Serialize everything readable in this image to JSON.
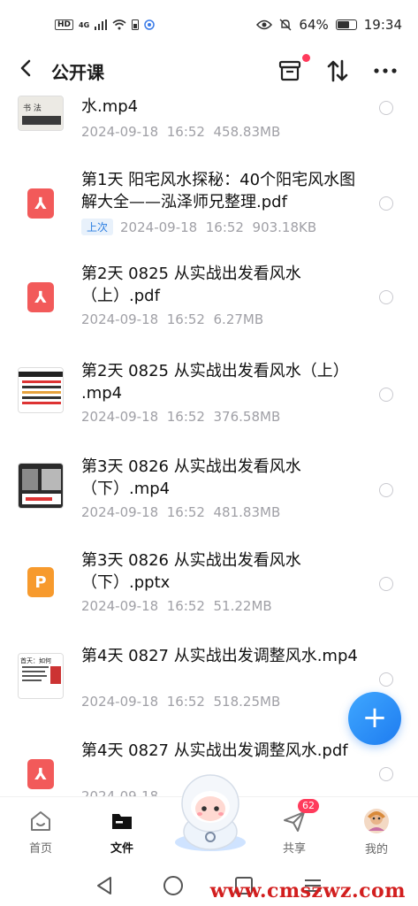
{
  "status_bar": {
    "network_hd": "HD",
    "network_4g": "4G",
    "battery_percent": "64%",
    "time": "19:34"
  },
  "header": {
    "title": "公开课"
  },
  "files": [
    {
      "name": "水.mp4",
      "date": "2024-09-18",
      "time": "16:52",
      "size": "458.83MB",
      "icon": "video-thumbnail",
      "tag": ""
    },
    {
      "name": "第1天  阳宅风水探秘：40个阳宅风水图解大全——泓泽师兄整理.pdf",
      "date": "2024-09-18",
      "time": "16:52",
      "size": "903.18KB",
      "icon": "pdf-icon",
      "tag": "上次"
    },
    {
      "name": "第2天  0825  从实战出发看风水（上）.pdf",
      "date": "2024-09-18",
      "time": "16:52",
      "size": "6.27MB",
      "icon": "pdf-icon",
      "tag": ""
    },
    {
      "name": "第2天  0825  从实战出发看风水（上） .mp4",
      "date": "2024-09-18",
      "time": "16:52",
      "size": "376.58MB",
      "icon": "video-thumbnail",
      "tag": ""
    },
    {
      "name": "第3天  0826  从实战出发看风水（下）.mp4",
      "date": "2024-09-18",
      "time": "16:52",
      "size": "481.83MB",
      "icon": "video-thumbnail",
      "tag": ""
    },
    {
      "name": "第3天  0826  从实战出发看风水（下）.pptx",
      "date": "2024-09-18",
      "time": "16:52",
      "size": "51.22MB",
      "icon": "ppt-icon",
      "tag": ""
    },
    {
      "name": "第4天  0827  从实战出发调整风水.mp4",
      "date": "2024-09-18",
      "time": "16:52",
      "size": "518.25MB",
      "icon": "video-thumbnail",
      "tag": ""
    },
    {
      "name": "第4天  0827  从实战出发调整风水.pdf",
      "date": "2024-09-18",
      "time": "",
      "size": "",
      "icon": "pdf-icon",
      "tag": ""
    }
  ],
  "tabs": [
    {
      "label": "首页",
      "icon": "home-icon"
    },
    {
      "label": "文件",
      "icon": "folder-icon"
    },
    {
      "label": "共享",
      "icon": "share-icon",
      "badge": "62"
    },
    {
      "label": "我的",
      "icon": "avatar"
    }
  ],
  "watermark": "www.cmszwz.com"
}
